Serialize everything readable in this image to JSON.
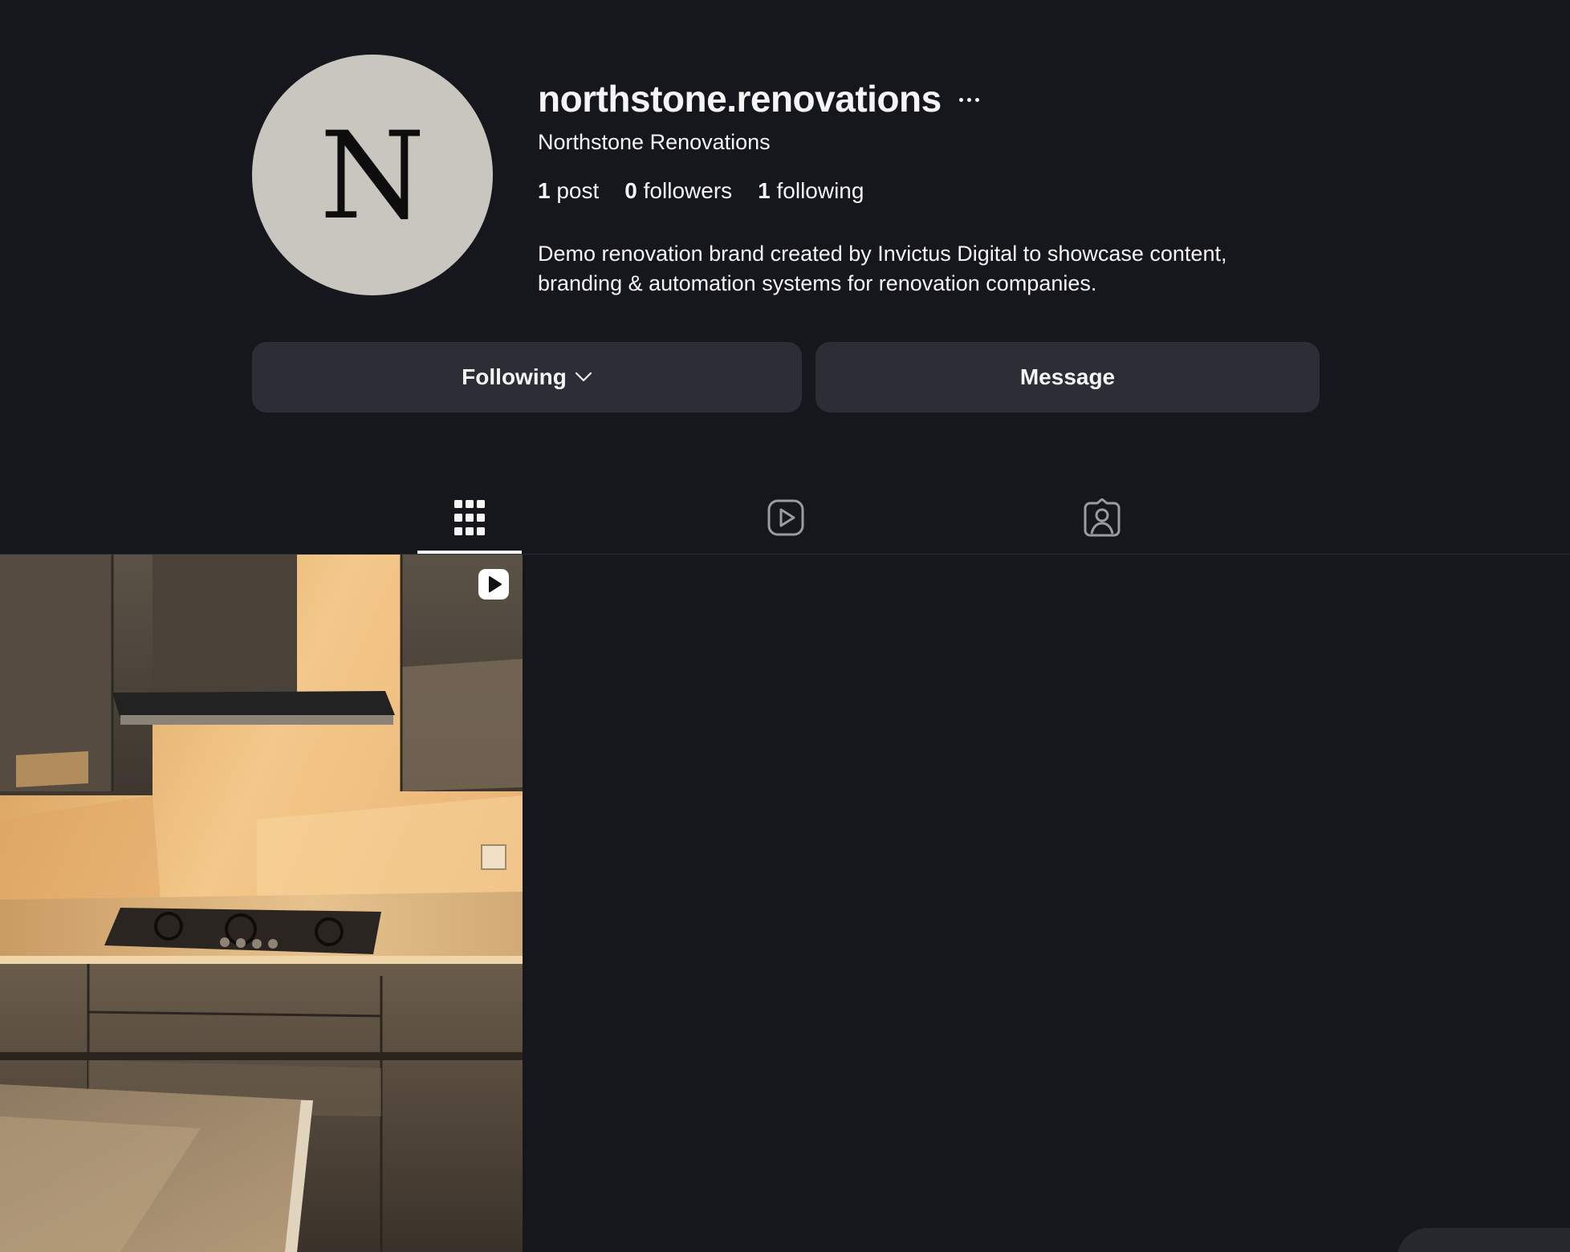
{
  "profile": {
    "avatar_letter": "N",
    "username": "northstone.renovations",
    "display_name": "Northstone Renovations",
    "stats": {
      "posts_count": "1",
      "posts_label": "post",
      "followers_count": "0",
      "followers_label": "followers",
      "following_count": "1",
      "following_label": "following"
    },
    "bio_lines": [
      "Demo renovation brand created by Invictus Digital to showcase content,",
      "branding & automation systems for renovation companies."
    ]
  },
  "actions": {
    "following_label": "Following",
    "message_label": "Message"
  },
  "tabs": [
    {
      "name": "posts",
      "icon": "grid-icon",
      "active": true
    },
    {
      "name": "reels",
      "icon": "reels-icon",
      "active": false
    },
    {
      "name": "tagged",
      "icon": "tagged-icon",
      "active": false
    }
  ],
  "posts": [
    {
      "type": "reel",
      "icon": "reel-play-icon",
      "subject": "kitchen"
    }
  ],
  "colors": {
    "background": "#16171c",
    "button": "#2b2e34",
    "avatar": "#c9c6c0",
    "text": "#f5f5f5"
  }
}
